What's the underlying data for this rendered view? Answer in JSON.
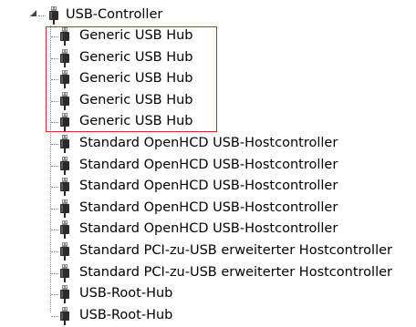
{
  "tree": {
    "category": {
      "label": "USB-Controller",
      "expanded": true,
      "icon": "usb-plug-icon"
    },
    "children": [
      {
        "label": "Generic USB Hub",
        "icon": "usb-plug-icon"
      },
      {
        "label": "Generic USB Hub",
        "icon": "usb-plug-icon"
      },
      {
        "label": "Generic USB Hub",
        "icon": "usb-plug-icon"
      },
      {
        "label": "Generic USB Hub",
        "icon": "usb-plug-icon"
      },
      {
        "label": "Generic USB Hub",
        "icon": "usb-plug-icon"
      },
      {
        "label": "Standard OpenHCD USB-Hostcontroller",
        "icon": "usb-plug-icon"
      },
      {
        "label": "Standard OpenHCD USB-Hostcontroller",
        "icon": "usb-plug-icon"
      },
      {
        "label": "Standard OpenHCD USB-Hostcontroller",
        "icon": "usb-plug-icon"
      },
      {
        "label": "Standard OpenHCD USB-Hostcontroller",
        "icon": "usb-plug-icon"
      },
      {
        "label": "Standard OpenHCD USB-Hostcontroller",
        "icon": "usb-plug-icon"
      },
      {
        "label": "Standard PCI-zu-USB erweiterter Hostcontroller",
        "icon": "usb-plug-icon"
      },
      {
        "label": "Standard PCI-zu-USB erweiterter Hostcontroller",
        "icon": "usb-plug-icon"
      },
      {
        "label": "USB-Root-Hub",
        "icon": "usb-plug-icon"
      },
      {
        "label": "USB-Root-Hub",
        "icon": "usb-plug-icon"
      }
    ]
  },
  "highlight": {
    "color": "#d42a2a"
  },
  "colors": {
    "icon_dark": "#2b2b2b",
    "icon_light": "#8a8a8a",
    "tree_lines": "#888888"
  }
}
